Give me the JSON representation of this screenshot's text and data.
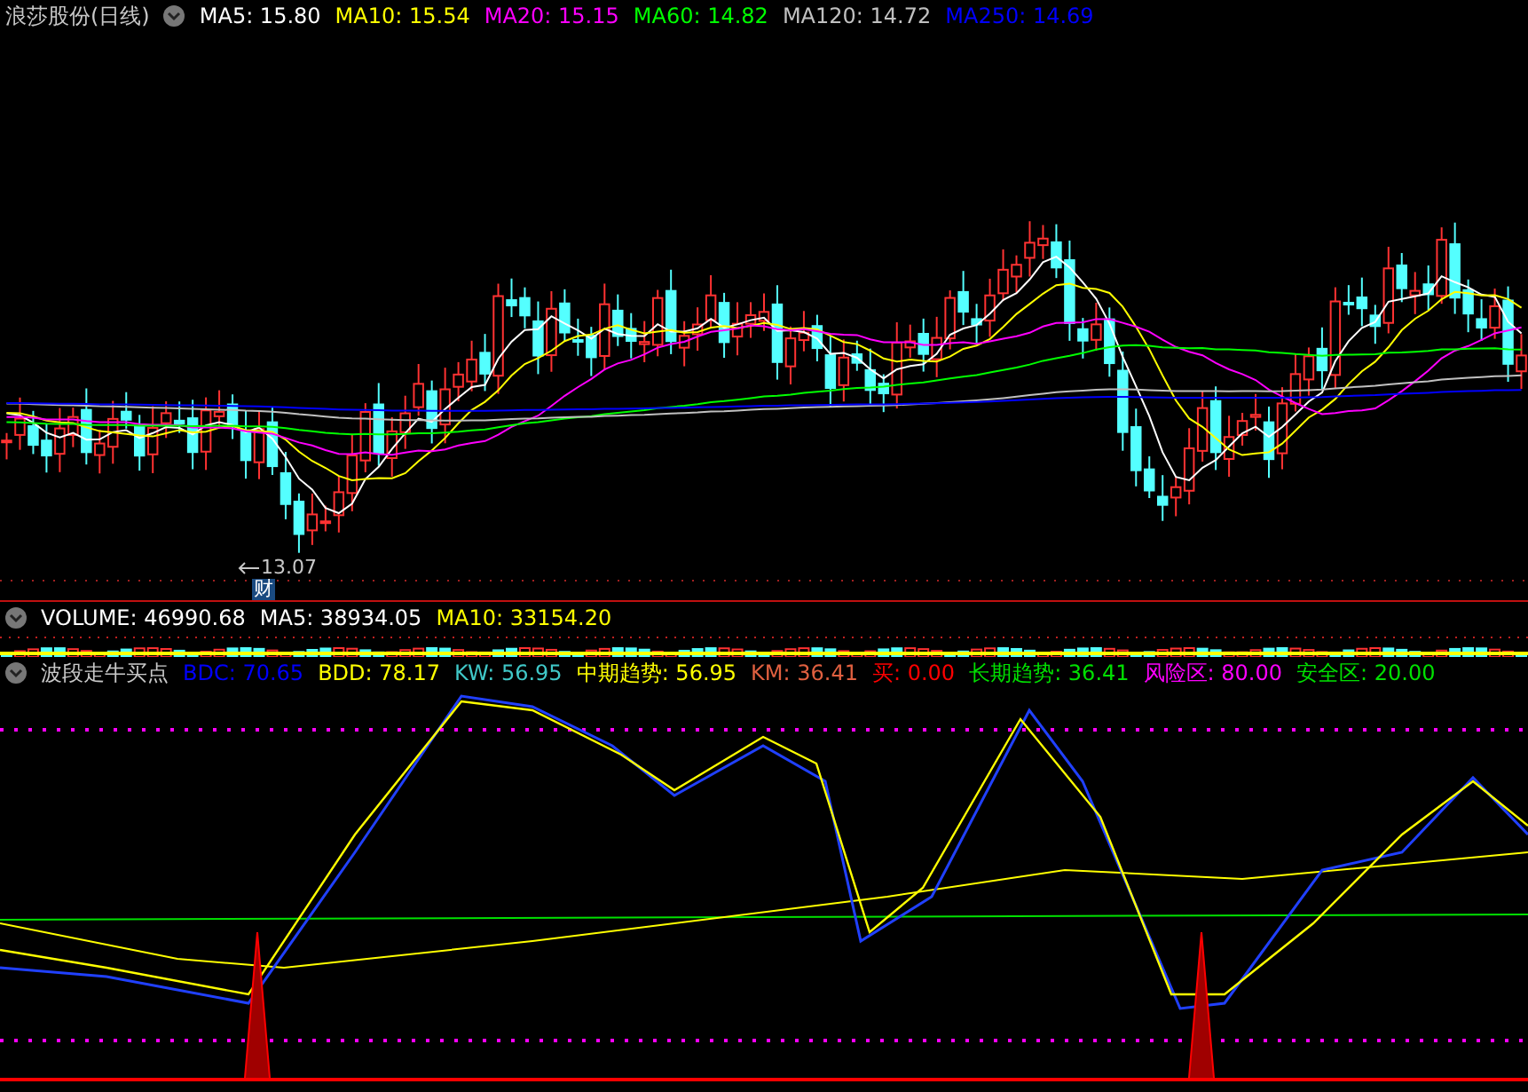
{
  "main_legend": {
    "title": "浪莎股份(日线)",
    "items": [
      {
        "label": "MA5: 15.80",
        "color": "#ffffff"
      },
      {
        "label": "MA10: 15.54",
        "color": "#ffff00"
      },
      {
        "label": "MA20: 15.15",
        "color": "#ff00ff"
      },
      {
        "label": "MA60: 14.82",
        "color": "#00ff00"
      },
      {
        "label": "MA120: 14.72",
        "color": "#c0c0c0"
      },
      {
        "label": "MA250: 14.69",
        "color": "#0000ff"
      }
    ]
  },
  "low_marker": {
    "price": "13.07",
    "badge": "财"
  },
  "volume_legend": {
    "items": [
      {
        "label": "VOLUME: 46990.68",
        "color": "#ffffff"
      },
      {
        "label": "MA5: 38934.05",
        "color": "#ffffff"
      },
      {
        "label": "MA10: 33154.20",
        "color": "#ffff00"
      }
    ]
  },
  "indicator_legend": {
    "title": "波段走牛买点",
    "items": [
      {
        "label": "BDC: 70.65",
        "color": "#0000ff"
      },
      {
        "label": "BDD: 78.17",
        "color": "#ffff00"
      },
      {
        "label": "KW: 56.95",
        "color": "#40c8c8"
      },
      {
        "label": "中期趋势: 56.95",
        "color": "#ffff00"
      },
      {
        "label": "KM: 36.41",
        "color": "#e06040"
      },
      {
        "label": "买: 0.00",
        "color": "#ff0000"
      },
      {
        "label": "长期趋势: 36.41",
        "color": "#00e000"
      },
      {
        "label": "风险区: 80.00",
        "color": "#ff00ff"
      },
      {
        "label": "安全区: 20.00",
        "color": "#00e000"
      }
    ]
  }
}
